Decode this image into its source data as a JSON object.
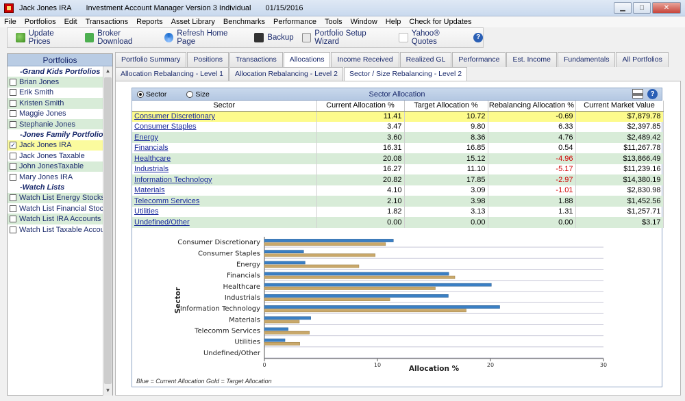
{
  "window": {
    "account": "Jack Jones IRA",
    "app_title": "Investment Account Manager Version 3 Individual",
    "date": "01/15/2016"
  },
  "menu": [
    "File",
    "Portfolios",
    "Edit",
    "Transactions",
    "Reports",
    "Asset Library",
    "Benchmarks",
    "Performance",
    "Tools",
    "Window",
    "Help",
    "Check for Updates"
  ],
  "toolbar": [
    {
      "label": "Update Prices",
      "icon": "update-prices-icon"
    },
    {
      "label": "Broker Download",
      "icon": "broker-download-icon"
    },
    {
      "label": "Refresh Home Page",
      "icon": "refresh-icon"
    },
    {
      "label": "Backup",
      "icon": "backup-icon"
    },
    {
      "label": "Portfolio Setup Wizard",
      "icon": "wizard-icon"
    },
    {
      "label": "Yahoo® Quotes",
      "icon": "yahoo-icon"
    }
  ],
  "sidebar": {
    "title": "Portfolios",
    "rows": [
      {
        "type": "group",
        "label": "-Grand Kids Portfolios"
      },
      {
        "type": "item",
        "label": "Brian Jones",
        "checked": false
      },
      {
        "type": "item",
        "label": "Erik Smith",
        "checked": false
      },
      {
        "type": "item",
        "label": "Kristen Smith",
        "checked": false
      },
      {
        "type": "item",
        "label": "Maggie Jones",
        "checked": false
      },
      {
        "type": "item",
        "label": "Stephanie Jones",
        "checked": false
      },
      {
        "type": "group",
        "label": "-Jones Family Portfolios"
      },
      {
        "type": "item",
        "label": "Jack Jones IRA",
        "checked": true,
        "selected": true
      },
      {
        "type": "item",
        "label": "Jack Jones Taxable",
        "checked": false
      },
      {
        "type": "item",
        "label": "John JonesTaxable",
        "checked": false
      },
      {
        "type": "item",
        "label": "Mary Jones IRA",
        "checked": false
      },
      {
        "type": "group",
        "label": "-Watch Lists"
      },
      {
        "type": "item",
        "label": "Watch List Energy Stocks",
        "checked": false
      },
      {
        "type": "item",
        "label": "Watch List Financial Stock",
        "checked": false
      },
      {
        "type": "item",
        "label": "Watch List IRA Accounts",
        "checked": false
      },
      {
        "type": "item",
        "label": "Watch List Taxable Accour",
        "checked": false
      }
    ]
  },
  "tabs": [
    "Portfolio Summary",
    "Positions",
    "Transactions",
    "Allocations",
    "Income Received",
    "Realized GL",
    "Performance",
    "Est. Income",
    "Fundamentals",
    "All Portfolios"
  ],
  "active_tab": "Allocations",
  "subtabs": [
    "Allocation Rebalancing - Level 1",
    "Allocation Rebalancing - Level 2",
    "Sector / Size Rebalancing - Level 2"
  ],
  "active_subtab": "Sector / Size Rebalancing - Level 2",
  "section": {
    "title": "Sector Allocation",
    "radio_sector": "Sector",
    "radio_size": "Size"
  },
  "table": {
    "columns": [
      "Sector",
      "Current Allocation %",
      "Target Allocation %",
      "Rebalancing Allocation %",
      "Current Market Value"
    ],
    "rows": [
      {
        "sector": "Consumer Discretionary",
        "current": "11.41",
        "target": "10.72",
        "rebalance": "-0.69",
        "value": "$7,879.78",
        "neg": false
      },
      {
        "sector": "Consumer Staples",
        "current": "3.47",
        "target": "9.80",
        "rebalance": "6.33",
        "value": "$2,397.85",
        "neg": false
      },
      {
        "sector": "Energy",
        "current": "3.60",
        "target": "8.36",
        "rebalance": "4.76",
        "value": "$2,489.42",
        "neg": false
      },
      {
        "sector": "Financials",
        "current": "16.31",
        "target": "16.85",
        "rebalance": "0.54",
        "value": "$11,267.78",
        "neg": false
      },
      {
        "sector": "Healthcare",
        "current": "20.08",
        "target": "15.12",
        "rebalance": "-4.96",
        "value": "$13,866.49",
        "neg": true
      },
      {
        "sector": "Industrials",
        "current": "16.27",
        "target": "11.10",
        "rebalance": "-5.17",
        "value": "$11,239.16",
        "neg": true
      },
      {
        "sector": "Information Technology",
        "current": "20.82",
        "target": "17.85",
        "rebalance": "-2.97",
        "value": "$14,380.19",
        "neg": true
      },
      {
        "sector": "Materials",
        "current": "4.10",
        "target": "3.09",
        "rebalance": "-1.01",
        "value": "$2,830.98",
        "neg": true
      },
      {
        "sector": "Telecomm Services",
        "current": "2.10",
        "target": "3.98",
        "rebalance": "1.88",
        "value": "$1,452.56",
        "neg": false
      },
      {
        "sector": "Utilities",
        "current": "1.82",
        "target": "3.13",
        "rebalance": "1.31",
        "value": "$1,257.71",
        "neg": false
      },
      {
        "sector": "Undefined/Other",
        "current": "0.00",
        "target": "0.00",
        "rebalance": "0.00",
        "value": "$3.17",
        "neg": false
      }
    ]
  },
  "chart_data": {
    "type": "bar",
    "orientation": "horizontal",
    "categories": [
      "Consumer Discretionary",
      "Consumer Staples",
      "Energy",
      "Financials",
      "Healthcare",
      "Industrials",
      "Information Technology",
      "Materials",
      "Telecomm Services",
      "Utilities",
      "Undefined/Other"
    ],
    "series": [
      {
        "name": "Current Allocation",
        "color": "#3a7fc4",
        "values": [
          11.41,
          3.47,
          3.6,
          16.31,
          20.08,
          16.27,
          20.82,
          4.1,
          2.1,
          1.82,
          0.0
        ]
      },
      {
        "name": "Target Allocation",
        "color": "#c9a86a",
        "values": [
          10.72,
          9.8,
          8.36,
          16.85,
          15.12,
          11.1,
          17.85,
          3.09,
          3.98,
          3.13,
          0.0
        ]
      }
    ],
    "xlabel": "Allocation %",
    "ylabel": "Sector",
    "xlim": [
      0,
      30
    ],
    "xticks": [
      0,
      10,
      20,
      30
    ],
    "grid": true,
    "note": "Blue = Current Allocation    Gold = Target Allocation"
  },
  "colors": {
    "highlight_row": "#fdfb8c",
    "alt_row": "#d8ecd8",
    "negative": "#d00000",
    "header_blue": "#b9cce4",
    "link": "#1a2a9c"
  }
}
